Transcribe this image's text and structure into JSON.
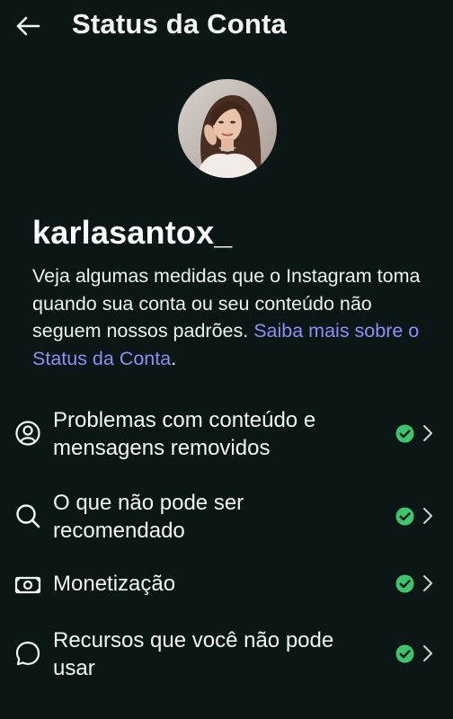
{
  "header": {
    "title": "Status da Conta"
  },
  "profile": {
    "username": "karlasantox_"
  },
  "description": {
    "text": "Veja algumas medidas que o Instagram toma quando sua conta ou seu conteúdo não seguem nossos padrões.",
    "link": "Saiba mais sobre o Status da Conta",
    "suffix": "."
  },
  "items": [
    {
      "label": "Problemas com conteúdo e mensagens removidos",
      "icon": "person-circle-icon",
      "status": "ok"
    },
    {
      "label": "O que não pode ser recomendado",
      "icon": "search-icon",
      "status": "ok"
    },
    {
      "label": "Monetização",
      "icon": "banknote-icon",
      "status": "ok"
    },
    {
      "label": "Recursos que você não pode usar",
      "icon": "speech-bubble-icon",
      "status": "ok"
    }
  ],
  "colors": {
    "background": "#0b1716",
    "link": "#8c90f4",
    "status_ok": "#3ec46c"
  }
}
